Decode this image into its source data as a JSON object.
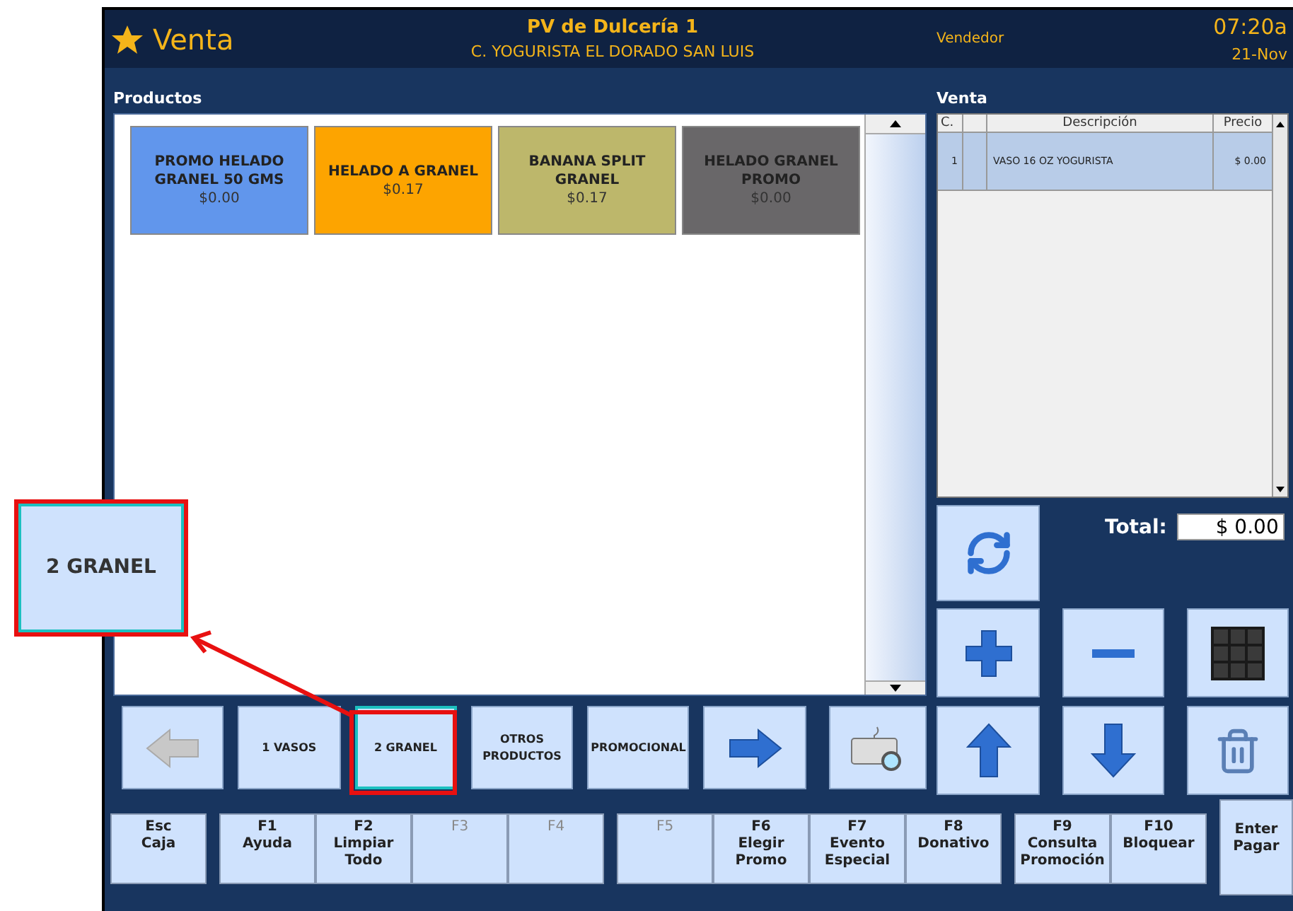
{
  "header": {
    "title": "Venta",
    "store": "PV de Dulcería 1",
    "branch": "C. YOGURISTA EL DORADO SAN LUIS",
    "role": "Vendedor",
    "time": "07:20a",
    "date": "21-Nov"
  },
  "products": {
    "label": "Productos",
    "items": [
      {
        "name": "PROMO HELADO GRANEL 50 GMS",
        "price": "$0.00",
        "color": "#6196ec"
      },
      {
        "name": "HELADO A GRANEL",
        "price": "$0.17",
        "color": "#fda400"
      },
      {
        "name": "BANANA SPLIT GRANEL",
        "price": "$0.17",
        "color": "#bdb76b"
      },
      {
        "name": "HELADO GRANEL PROMO",
        "price": "$0.00",
        "color": "#696769"
      }
    ]
  },
  "sale": {
    "label": "Venta",
    "columns": [
      "C.",
      "Descripción",
      "Precio"
    ],
    "rows": [
      {
        "qty": "1",
        "description": "VASO 16 OZ YOGURISTA",
        "price": "$ 0.00",
        "selected": true
      }
    ],
    "total_label": "Total:",
    "total": "$ 0.00"
  },
  "categories": [
    {
      "kind": "arrow-left",
      "disabled": true
    },
    {
      "kind": "text",
      "label": "1 VASOS",
      "selected": false
    },
    {
      "kind": "text",
      "label": "2 GRANEL",
      "selected": true
    },
    {
      "kind": "text",
      "label": "OTROS PRODUCTOS",
      "selected": false
    },
    {
      "kind": "text",
      "label": "PROMOCIONAL",
      "selected": false
    },
    {
      "kind": "arrow-right",
      "disabled": false
    },
    {
      "kind": "keyboard"
    }
  ],
  "function_key_groups": [
    [
      {
        "key": "Esc",
        "label": "Caja",
        "disabled": false
      }
    ],
    [
      {
        "key": "F1",
        "label": "Ayuda",
        "disabled": false
      },
      {
        "key": "F2",
        "label": "Limpiar Todo",
        "disabled": false
      },
      {
        "key": "F3",
        "disabled": true
      },
      {
        "key": "F4",
        "disabled": true
      }
    ],
    [
      {
        "key": "F5",
        "disabled": true
      },
      {
        "key": "F6",
        "label": "Elegir Promo",
        "disabled": false
      },
      {
        "key": "F7",
        "label": "Evento Especial",
        "disabled": false
      },
      {
        "key": "F8",
        "label": "Donativo",
        "disabled": false
      }
    ],
    [
      {
        "key": "F9",
        "label": "Consulta Promoción",
        "disabled": false
      },
      {
        "key": "F10",
        "label": "Bloquear",
        "disabled": false
      }
    ]
  ],
  "enter_button": {
    "key": "Enter",
    "label": "Pagar"
  },
  "callout": {
    "label": "2 GRANEL"
  }
}
